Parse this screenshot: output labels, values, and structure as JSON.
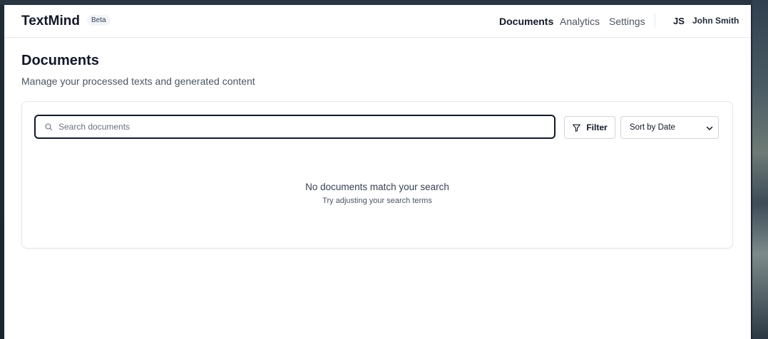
{
  "app": {
    "name": "TextMind",
    "badge": "Beta"
  },
  "nav": {
    "items": [
      {
        "label": "Documents",
        "active": true
      },
      {
        "label": "Analytics",
        "active": false
      },
      {
        "label": "Settings",
        "active": false
      }
    ]
  },
  "user": {
    "initials": "JS",
    "name": "John Smith"
  },
  "page": {
    "title": "Documents",
    "subtitle": "Manage your processed texts and generated content"
  },
  "search": {
    "placeholder": "Search documents",
    "value": "",
    "icon": "search-icon"
  },
  "toolbar": {
    "filter_label": "Filter",
    "filter_icon": "funnel-icon",
    "sort_value": "Sort by Date"
  },
  "empty_state": {
    "title": "No documents match your search",
    "subtitle": "Try adjusting your search terms"
  },
  "colors": {
    "text_primary": "#111827",
    "text_secondary": "#4b5563",
    "border": "#e5e7eb"
  }
}
